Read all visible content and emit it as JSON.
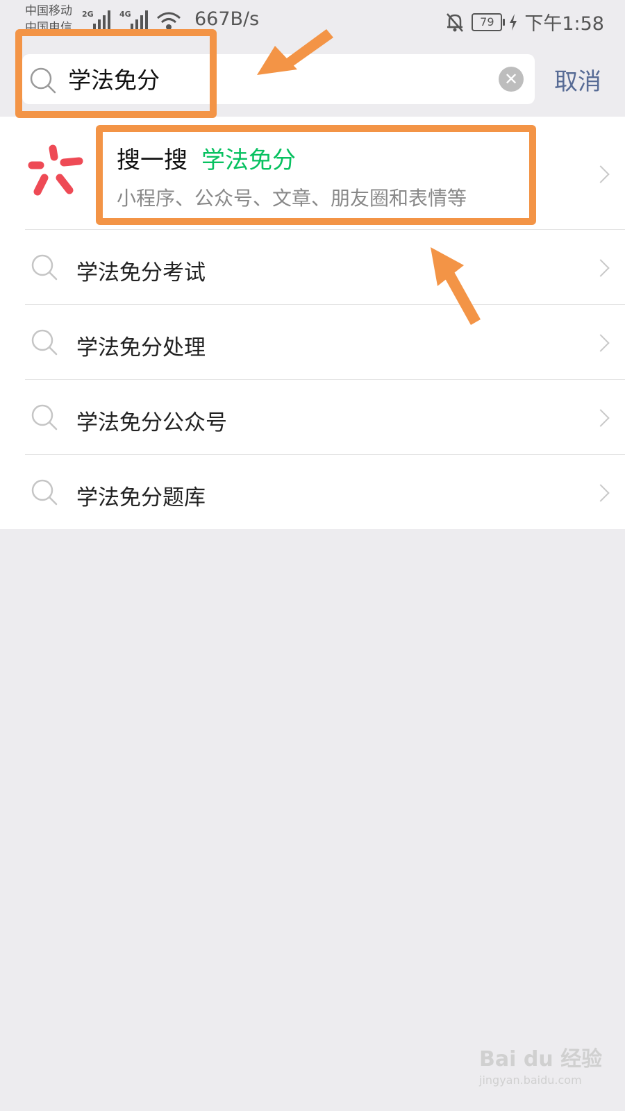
{
  "status_bar": {
    "carrier_1": "中国移动",
    "carrier_2": "中国电信",
    "net_1": "2G",
    "net_2": "4G",
    "speed": "667B/s",
    "battery": "79",
    "time": "下午1:58"
  },
  "search": {
    "value": "学法免分",
    "cancel_label": "取消"
  },
  "sousou": {
    "title": "搜一搜",
    "keyword": "学法免分",
    "subtitle": "小程序、公众号、文章、朋友圈和表情等"
  },
  "suggestions": [
    {
      "label": "学法免分考试"
    },
    {
      "label": "学法免分处理"
    },
    {
      "label": "学法免分公众号"
    },
    {
      "label": "学法免分题库"
    }
  ],
  "watermark": {
    "main": "Bai du 经验",
    "sub": "jingyan.baidu.com"
  },
  "colors": {
    "accent_green": "#07c160",
    "link_blue": "#576b95",
    "annotation_orange": "#f39446",
    "logo_red": "#ee4a55"
  }
}
